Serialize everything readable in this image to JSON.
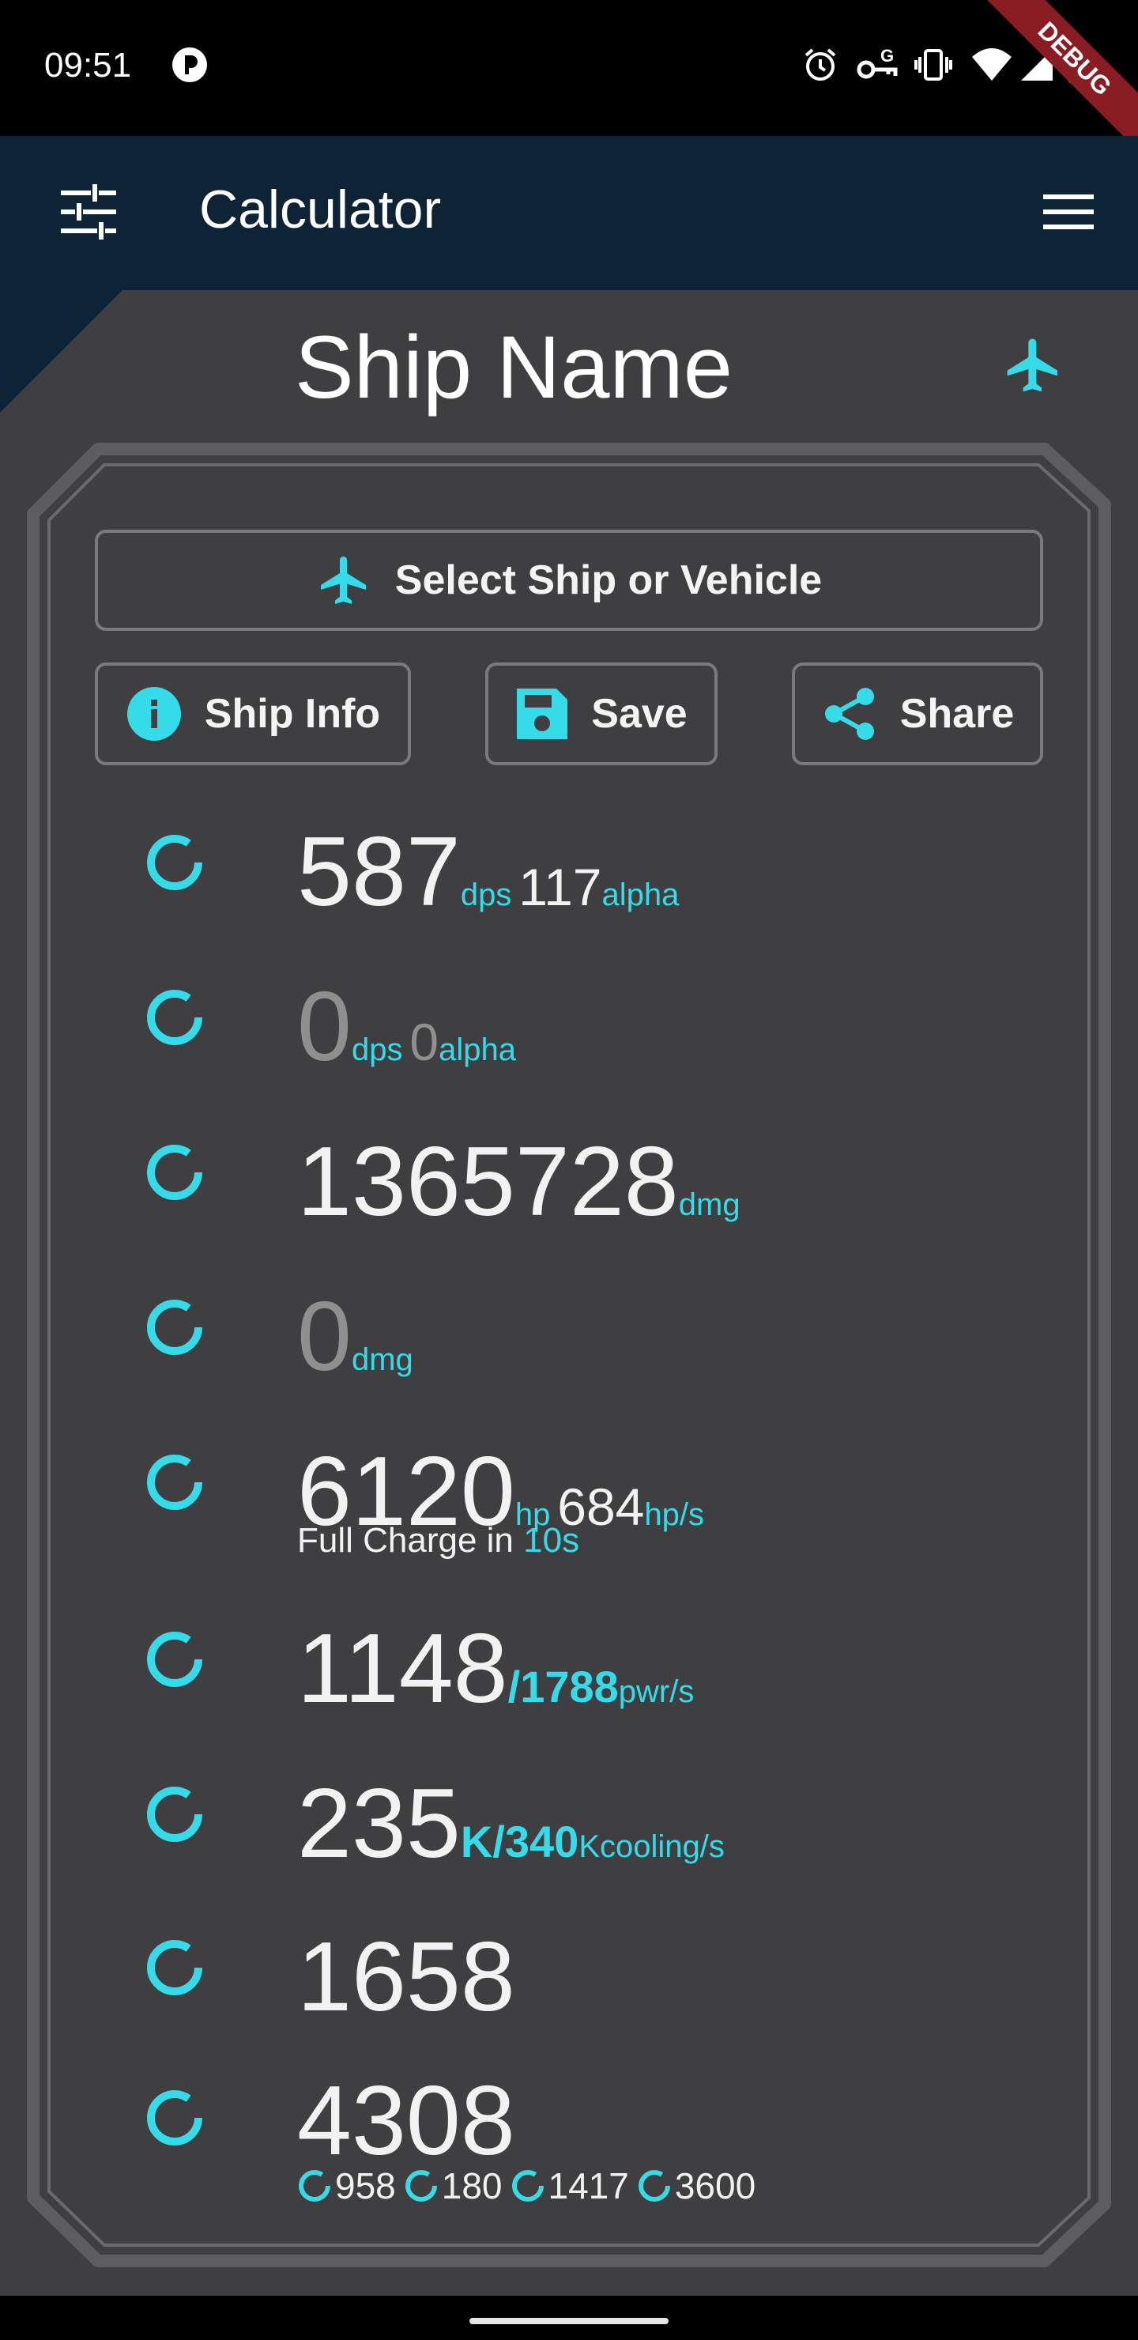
{
  "status_bar": {
    "time": "09:51",
    "debug_label": "DEBUG",
    "icons": [
      "app-status-icon",
      "alarm-icon",
      "vpn-key-icon",
      "vibrate-icon",
      "wifi-icon",
      "signal-icon",
      "battery-icon"
    ]
  },
  "app_bar": {
    "title": "Calculator",
    "left_icon": "tune-icon",
    "right_icon": "menu-icon"
  },
  "ship": {
    "name": "Ship Name",
    "icon": "airplane-icon"
  },
  "buttons": {
    "select_ship": "Select Ship or Vehicle",
    "ship_info": "Ship Info",
    "save": "Save",
    "share": "Share"
  },
  "stats": {
    "weapons": {
      "value": "587",
      "unit": "dps",
      "alpha": "117",
      "alpha_unit": "alpha"
    },
    "secondary_weapons": {
      "value": "0",
      "unit": "dps",
      "alpha": "0",
      "alpha_unit": "alpha"
    },
    "damage": {
      "value": "1365728",
      "unit": "dmg"
    },
    "secondary_damage": {
      "value": "0",
      "unit": "dmg"
    },
    "shield": {
      "value": "6120",
      "unit": "hp",
      "regen": "684",
      "regen_unit": "hp/s",
      "charge_prefix": "Full Charge in",
      "charge_time": "10s"
    },
    "power": {
      "value": "1148",
      "capacity": "/1788",
      "unit": "pwr/s"
    },
    "cooling": {
      "value": "235",
      "capacity": "K/340",
      "unit": "Kcooling/s"
    },
    "single_value": {
      "value": "1658"
    },
    "hull": {
      "value": "4308",
      "parts": [
        "958",
        "180",
        "1417",
        "3600"
      ]
    }
  },
  "colors": {
    "accent": "#35dbe8",
    "background": "#3f3f41",
    "app_bar": "#0e2336",
    "frame": "#5a5a5c",
    "text": "#f2f2f2",
    "muted": "#8f8f90"
  }
}
